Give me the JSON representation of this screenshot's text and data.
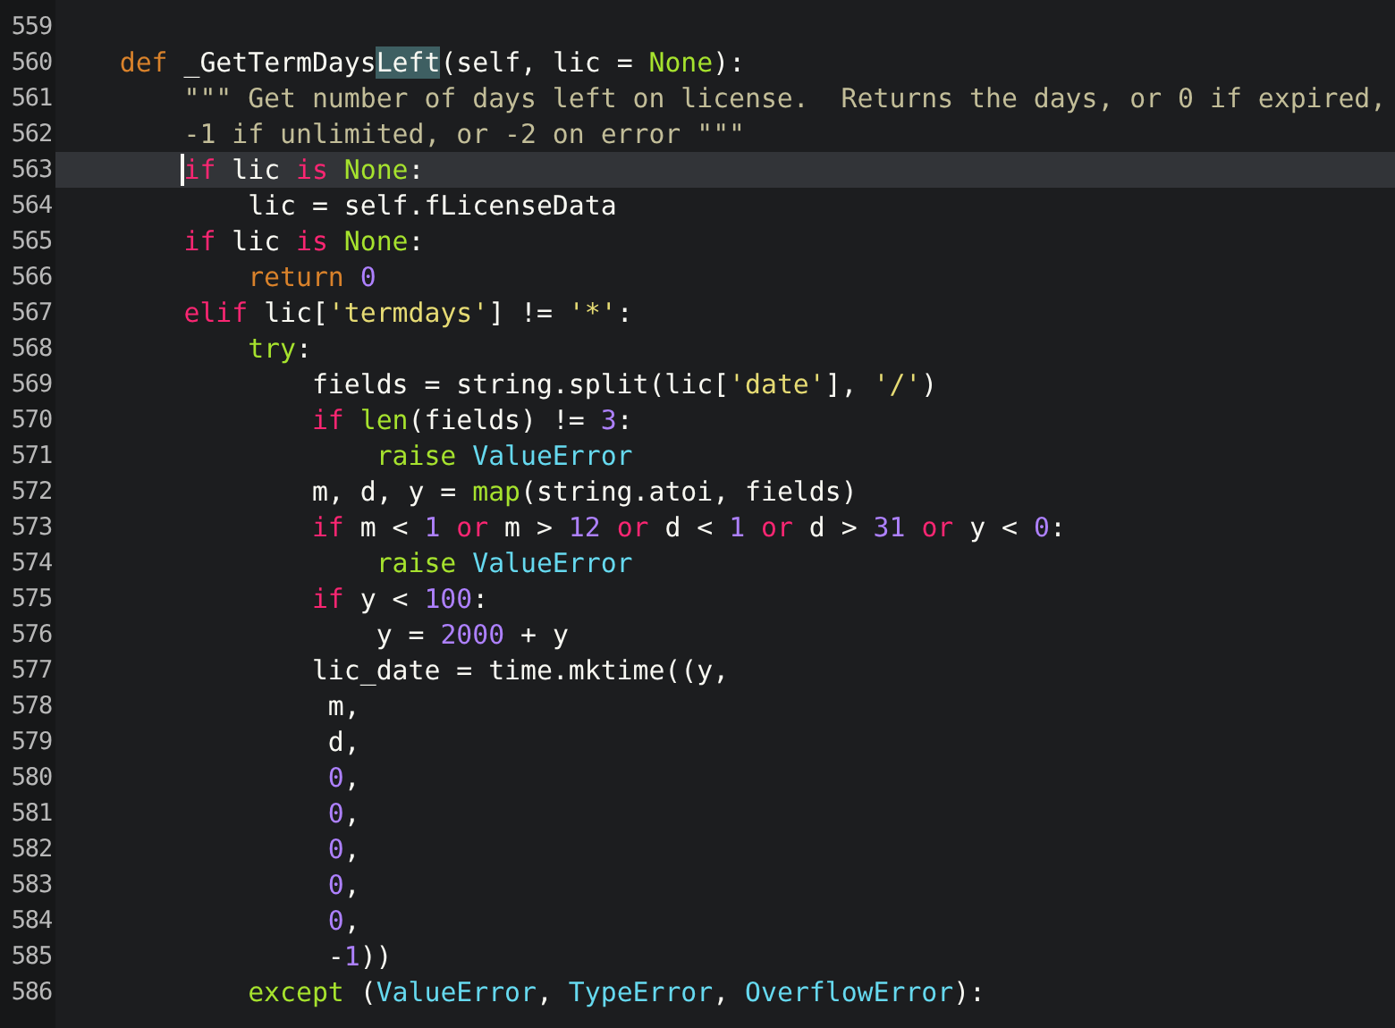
{
  "editor": {
    "lines": [
      {
        "number": "559",
        "current": false
      },
      {
        "number": "560",
        "current": false,
        "tokens": [
          {
            "text": "    def",
            "kind": "decl"
          },
          {
            "text": " _GetTermDays",
            "kind": "plain"
          },
          {
            "text": "Left",
            "kind": "match"
          },
          {
            "text": "(self, lic = ",
            "kind": "plain"
          },
          {
            "text": "None",
            "kind": "const"
          },
          {
            "text": "):",
            "kind": "plain"
          }
        ]
      },
      {
        "number": "561",
        "current": false,
        "tokens": [
          {
            "text": "        \"\"\" Get number of days left on license.  Returns the days, or 0 if expired,",
            "kind": "doc"
          }
        ]
      },
      {
        "number": "562",
        "current": false,
        "tokens": [
          {
            "text": "        -1 if unlimited, or -2 on error \"\"\"",
            "kind": "doc"
          }
        ]
      },
      {
        "number": "563",
        "current": true,
        "tokens": [
          {
            "text": "        if",
            "kind": "kw"
          },
          {
            "text": " lic ",
            "kind": "plain"
          },
          {
            "text": "is",
            "kind": "kw"
          },
          {
            "text": " None",
            "kind": "const"
          },
          {
            "text": ":",
            "kind": "plain"
          }
        ]
      },
      {
        "number": "564",
        "current": false,
        "tokens": [
          {
            "text": "            lic = self.fLicenseData",
            "kind": "plain"
          }
        ]
      },
      {
        "number": "565",
        "current": false,
        "tokens": [
          {
            "text": "        if",
            "kind": "kw"
          },
          {
            "text": " lic ",
            "kind": "plain"
          },
          {
            "text": "is",
            "kind": "kw"
          },
          {
            "text": " None",
            "kind": "const"
          },
          {
            "text": ":",
            "kind": "plain"
          }
        ]
      },
      {
        "number": "566",
        "current": false,
        "tokens": [
          {
            "text": "            return",
            "kind": "decl"
          },
          {
            "text": " 0",
            "kind": "num"
          }
        ]
      },
      {
        "number": "567",
        "current": false,
        "tokens": [
          {
            "text": "        elif",
            "kind": "kw"
          },
          {
            "text": " lic[",
            "kind": "plain"
          },
          {
            "text": "'termdays'",
            "kind": "str"
          },
          {
            "text": "] != ",
            "kind": "plain"
          },
          {
            "text": "'*'",
            "kind": "str"
          },
          {
            "text": ":",
            "kind": "plain"
          }
        ]
      },
      {
        "number": "568",
        "current": false,
        "tokens": [
          {
            "text": "            try",
            "kind": "const"
          },
          {
            "text": ":",
            "kind": "plain"
          }
        ]
      },
      {
        "number": "569",
        "current": false,
        "tokens": [
          {
            "text": "                fields = string.split(lic[",
            "kind": "plain"
          },
          {
            "text": "'date'",
            "kind": "str"
          },
          {
            "text": "], ",
            "kind": "plain"
          },
          {
            "text": "'/'",
            "kind": "str"
          },
          {
            "text": ")",
            "kind": "plain"
          }
        ]
      },
      {
        "number": "570",
        "current": false,
        "tokens": [
          {
            "text": "                if",
            "kind": "kw"
          },
          {
            "text": " len",
            "kind": "const"
          },
          {
            "text": "(fields) != ",
            "kind": "plain"
          },
          {
            "text": "3",
            "kind": "num"
          },
          {
            "text": ":",
            "kind": "plain"
          }
        ]
      },
      {
        "number": "571",
        "current": false,
        "tokens": [
          {
            "text": "                    raise",
            "kind": "const"
          },
          {
            "text": " ValueError",
            "kind": "type"
          }
        ]
      },
      {
        "number": "572",
        "current": false,
        "tokens": [
          {
            "text": "                m, d, y = ",
            "kind": "plain"
          },
          {
            "text": "map",
            "kind": "const"
          },
          {
            "text": "(string.atoi, fields)",
            "kind": "plain"
          }
        ]
      },
      {
        "number": "573",
        "current": false,
        "tokens": [
          {
            "text": "                if",
            "kind": "kw"
          },
          {
            "text": " m < ",
            "kind": "plain"
          },
          {
            "text": "1",
            "kind": "num"
          },
          {
            "text": " or",
            "kind": "kw"
          },
          {
            "text": " m > ",
            "kind": "plain"
          },
          {
            "text": "12",
            "kind": "num"
          },
          {
            "text": " or",
            "kind": "kw"
          },
          {
            "text": " d < ",
            "kind": "plain"
          },
          {
            "text": "1",
            "kind": "num"
          },
          {
            "text": " or",
            "kind": "kw"
          },
          {
            "text": " d > ",
            "kind": "plain"
          },
          {
            "text": "31",
            "kind": "num"
          },
          {
            "text": " or",
            "kind": "kw"
          },
          {
            "text": " y < ",
            "kind": "plain"
          },
          {
            "text": "0",
            "kind": "num"
          },
          {
            "text": ":",
            "kind": "plain"
          }
        ]
      },
      {
        "number": "574",
        "current": false,
        "tokens": [
          {
            "text": "                    raise",
            "kind": "const"
          },
          {
            "text": " ValueError",
            "kind": "type"
          }
        ]
      },
      {
        "number": "575",
        "current": false,
        "tokens": [
          {
            "text": "                if",
            "kind": "kw"
          },
          {
            "text": " y < ",
            "kind": "plain"
          },
          {
            "text": "100",
            "kind": "num"
          },
          {
            "text": ":",
            "kind": "plain"
          }
        ]
      },
      {
        "number": "576",
        "current": false,
        "tokens": [
          {
            "text": "                    y = ",
            "kind": "plain"
          },
          {
            "text": "2000",
            "kind": "num"
          },
          {
            "text": " + y",
            "kind": "plain"
          }
        ]
      },
      {
        "number": "577",
        "current": false,
        "tokens": [
          {
            "text": "                lic_date = time.mktime((y,",
            "kind": "plain"
          }
        ]
      },
      {
        "number": "578",
        "current": false,
        "tokens": [
          {
            "text": "                 m,",
            "kind": "plain"
          }
        ]
      },
      {
        "number": "579",
        "current": false,
        "tokens": [
          {
            "text": "                 d,",
            "kind": "plain"
          }
        ]
      },
      {
        "number": "580",
        "current": false,
        "tokens": [
          {
            "text": "                 0",
            "kind": "num"
          },
          {
            "text": ",",
            "kind": "plain"
          }
        ]
      },
      {
        "number": "581",
        "current": false,
        "tokens": [
          {
            "text": "                 0",
            "kind": "num"
          },
          {
            "text": ",",
            "kind": "plain"
          }
        ]
      },
      {
        "number": "582",
        "current": false,
        "tokens": [
          {
            "text": "                 0",
            "kind": "num"
          },
          {
            "text": ",",
            "kind": "plain"
          }
        ]
      },
      {
        "number": "583",
        "current": false,
        "tokens": [
          {
            "text": "                 0",
            "kind": "num"
          },
          {
            "text": ",",
            "kind": "plain"
          }
        ]
      },
      {
        "number": "584",
        "current": false,
        "tokens": [
          {
            "text": "                 0",
            "kind": "num"
          },
          {
            "text": ",",
            "kind": "plain"
          }
        ]
      },
      {
        "number": "585",
        "current": false,
        "tokens": [
          {
            "text": "                 -",
            "kind": "plain"
          },
          {
            "text": "1",
            "kind": "num"
          },
          {
            "text": "))",
            "kind": "plain"
          }
        ]
      },
      {
        "number": "586",
        "current": false,
        "tokens": [
          {
            "text": "            except",
            "kind": "const"
          },
          {
            "text": " (",
            "kind": "plain"
          },
          {
            "text": "ValueError",
            "kind": "type"
          },
          {
            "text": ", ",
            "kind": "plain"
          },
          {
            "text": "TypeError",
            "kind": "type"
          },
          {
            "text": ", ",
            "kind": "plain"
          },
          {
            "text": "OverflowError",
            "kind": "type"
          },
          {
            "text": "):",
            "kind": "plain"
          }
        ]
      }
    ]
  }
}
